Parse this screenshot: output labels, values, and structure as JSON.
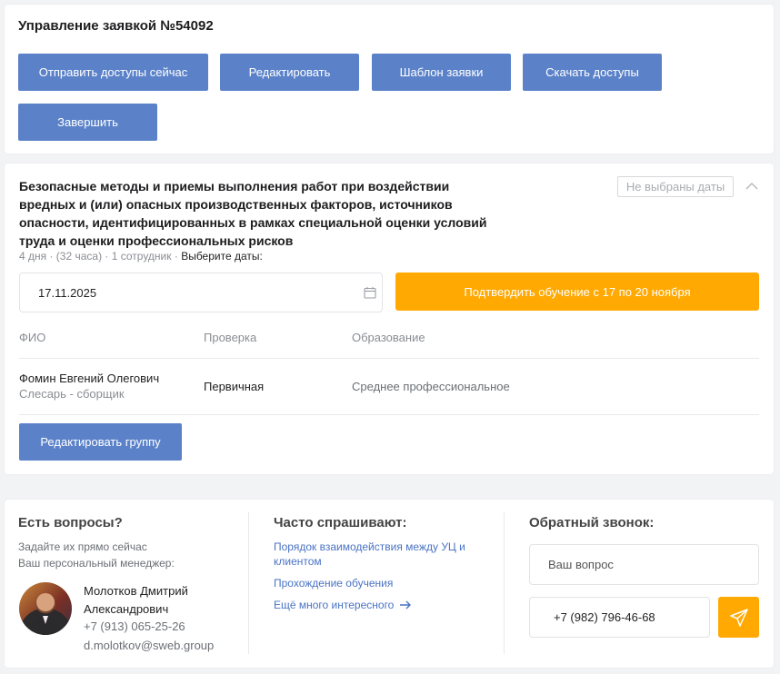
{
  "request": {
    "title": "Управление заявкой №54092",
    "buttons": {
      "send_access": "Отправить доступы сейчас",
      "edit": "Редактировать",
      "template": "Шаблон заявки",
      "download_access": "Скачать доступы",
      "finish": "Завершить"
    }
  },
  "course": {
    "title_lines": [
      "Безопасные методы и приемы выполнения работ при воздействии",
      "вредных и (или) опасных производственных факторов, источников",
      "опасности, идентифицированных в рамках специальной оценки условий",
      "труда и оценки профессиональных рисков"
    ],
    "dates_badge": "Не выбраны даты",
    "meta": "4 дня · (32 часа) · 1 сотрудник ·",
    "meta_choose": "Выберите даты:",
    "date_value": "17.11.2025",
    "confirm_button": "Подтвердить обучение с 17 по 20 ноября",
    "columns": {
      "name": "ФИО",
      "check": "Проверка",
      "education": "Образование"
    },
    "rows": [
      {
        "name": "Фомин Евгений Олегович",
        "position": "Слесарь - сборщик",
        "check": "Первичная",
        "education": "Среднее профессиональное"
      }
    ],
    "edit_group_button": "Редактировать группу"
  },
  "footer": {
    "questions": {
      "title": "Есть вопросы?",
      "line1": "Задайте их прямо сейчас",
      "line2": "Ваш персональный менеджер:",
      "manager_name_1": "Молотков Дмитрий",
      "manager_name_2": "Александрович",
      "manager_phone": "+7 (913) 065-25-26",
      "manager_email": "d.molotkov@sweb.group"
    },
    "faq": {
      "title": "Часто спрашивают:",
      "link1_line1": "Порядок взаимодействия между УЦ и",
      "link1_line2": "клиентом",
      "link2": "Прохождение обучения",
      "link3": "Ещё много интересного"
    },
    "callback": {
      "title": "Обратный звонок:",
      "question_placeholder": "Ваш вопрос",
      "phone_value": "+7 (982) 796-46-68"
    }
  },
  "colors": {
    "primary": "#5b82c9",
    "accent": "#ffa902"
  }
}
